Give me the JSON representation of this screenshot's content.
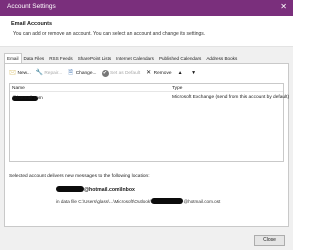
{
  "window": {
    "title": "Account Settings",
    "close_glyph": "✕"
  },
  "header": {
    "title": "Email Accounts",
    "description": "You can add or remove an account. You can select an account and change its settings."
  },
  "tabs": [
    {
      "label": "Email",
      "active": true
    },
    {
      "label": "Data Files"
    },
    {
      "label": "RSS Feeds"
    },
    {
      "label": "SharePoint Lists"
    },
    {
      "label": "Internet Calendars"
    },
    {
      "label": "Published Calendars"
    },
    {
      "label": "Address Books"
    }
  ],
  "toolbar": {
    "new": {
      "label": "New...",
      "icon": "new-account-icon",
      "glyph": "🖂"
    },
    "repair": {
      "label": "Repair...",
      "icon": "repair-icon",
      "glyph": "🔧",
      "enabled": false
    },
    "change": {
      "label": "Change...",
      "icon": "change-icon",
      "glyph": "🗎"
    },
    "set_default": {
      "label": "Set as Default",
      "icon": "check-icon",
      "glyph": "✔",
      "enabled": false
    },
    "remove": {
      "label": "Remove",
      "icon": "remove-icon",
      "glyph": "✕"
    },
    "move_up": {
      "glyph": "▲"
    },
    "move_down": {
      "glyph": "▼"
    }
  },
  "accounts_list": {
    "columns": {
      "name": "Name",
      "type": "Type"
    },
    "rows": [
      {
        "name": "@hotmail.com",
        "type": "Microsoft Exchange (send from this account by default)"
      }
    ]
  },
  "delivery": {
    "text": "Selected account delivers new messages to the following location:",
    "location": "@hotmail.com\\Inbox",
    "data_file_prefix": "in data file C:\\Users\\glass\\...\\Microsoft\\Outlook\\",
    "data_file_suffix": "@hotmail.com.ost"
  },
  "footer": {
    "close_label": "Close"
  },
  "colors": {
    "titlebar": "#7a2f7c"
  }
}
